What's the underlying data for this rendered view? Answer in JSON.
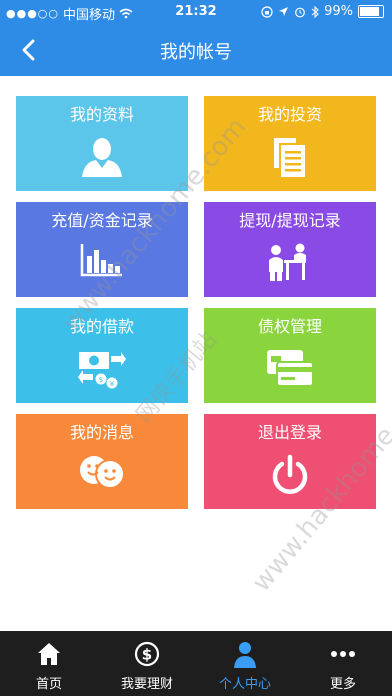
{
  "status_bar": {
    "signal": "●●●○○",
    "carrier": "中国移动",
    "time": "21:32",
    "battery": "99%"
  },
  "nav": {
    "title": "我的帐号"
  },
  "tiles": [
    {
      "label": "我的资料",
      "icon": "user-icon",
      "color": "#5cc6ea"
    },
    {
      "label": "我的投资",
      "icon": "documents-icon",
      "color": "#f1b71c"
    },
    {
      "label": "充值/资金记录",
      "icon": "bar-chart-icon",
      "color": "#5a78e2"
    },
    {
      "label": "提现/提现记录",
      "icon": "counter-service-icon",
      "color": "#8a4ae6"
    },
    {
      "label": "我的借款",
      "icon": "money-transfer-icon",
      "color": "#3cc0ea"
    },
    {
      "label": "债权管理",
      "icon": "cards-icon",
      "color": "#8ad43e"
    },
    {
      "label": "我的消息",
      "icon": "chat-faces-icon",
      "color": "#f9893a"
    },
    {
      "label": "退出登录",
      "icon": "power-icon",
      "color": "#ef4f72"
    }
  ],
  "watermarks": [
    "www.hackhome.com",
    "网侠手机站",
    "www.hackhome.com"
  ],
  "tab_bar": {
    "items": [
      {
        "label": "首页",
        "icon": "home-icon",
        "active": false
      },
      {
        "label": "我要理财",
        "icon": "dollar-coin-icon",
        "active": false
      },
      {
        "label": "个人中心",
        "icon": "person-icon",
        "active": true
      },
      {
        "label": "更多",
        "icon": "more-dots-icon",
        "active": false
      }
    ],
    "active_color": "#3a9cf3"
  }
}
